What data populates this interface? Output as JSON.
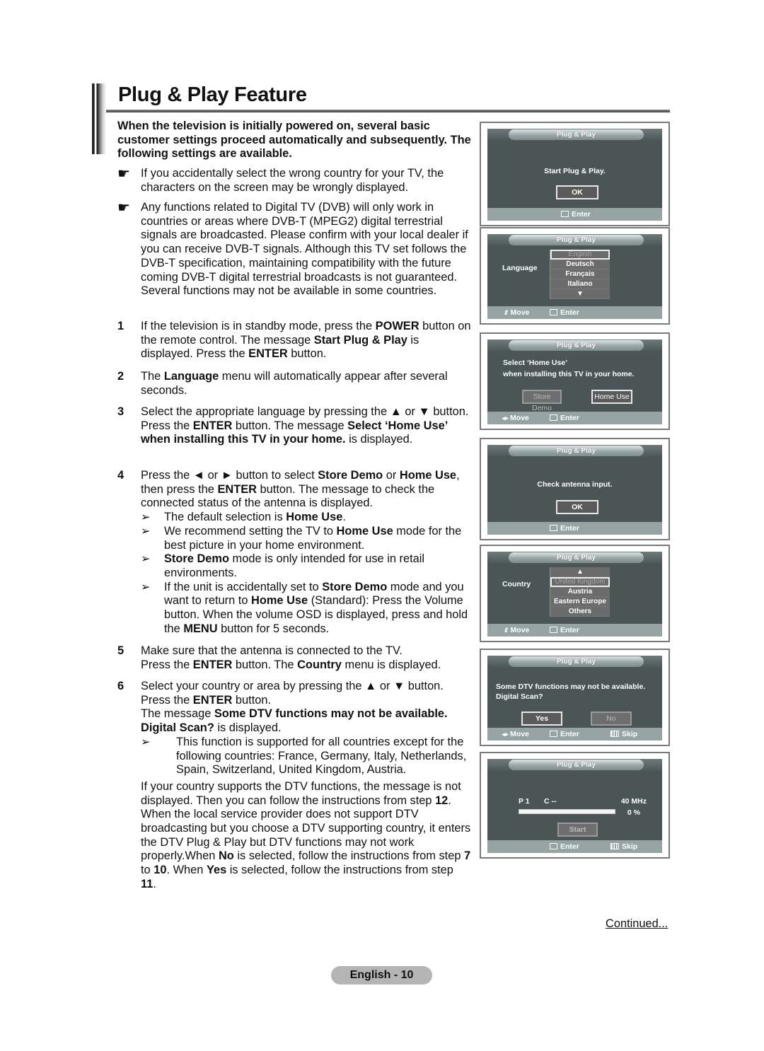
{
  "header": {
    "title": "Plug & Play Feature"
  },
  "intro": "When the television is initially powered on, several basic customer settings proceed automatically and subsequently. The following settings are available.",
  "notes": [
    {
      "icon": "pointing-hand-icon",
      "text": "If you accidentally select the wrong country for your TV, the characters on the screen may be wrongly displayed."
    },
    {
      "icon": "pointing-hand-icon",
      "text": "Any functions related to Digital TV (DVB) will only work in countries or areas where DVB-T (MPEG2) digital terrestrial signals are broadcasted. Please confirm with your local dealer if you can receive DVB-T signals. Although this TV set follows the DVB-T specification, maintaining compatibility with the future coming DVB-T digital terrestrial broadcasts is not guaranteed. Several functions may not be available in some countries."
    }
  ],
  "steps": [
    {
      "num": "1",
      "html": "If the television is in standby mode, press the <b>POWER</b> button on the remote control. The message <b>Start Plug &amp; Play</b> is displayed. Press the <b>ENTER</b> button."
    },
    {
      "num": "2",
      "html": "The <b>Language</b> menu will automatically appear after several seconds."
    },
    {
      "num": "3",
      "html": "Select the appropriate language by pressing the ▲ or ▼ button.<br>Press the <b>ENTER</b> button. The message <b>Select ‘Home Use’ when installing this TV in your home.</b> is displayed."
    },
    {
      "num": "4",
      "html": "Press the ◄ or ► button to select <b>Store Demo</b> or <b>Home Use</b>, then press the <b>ENTER</b> button. The message to check the connected status of the antenna is displayed.",
      "subs": [
        "The default selection is <b>Home Use</b>.",
        "We recommend setting the TV to <b>Home Use</b> mode for the best picture in your home environment.",
        "<b>Store Demo</b> mode is only intended for use in retail environments.",
        "If the unit is accidentally set to <b>Store Demo</b> mode and you want to return to <b>Home Use</b> (Standard): Press the Volume button. When the volume OSD is displayed, press and hold the <b>MENU</b> button for 5 seconds."
      ]
    },
    {
      "num": "5",
      "html": "Make sure that the antenna is connected to the TV.<br>Press the <b>ENTER</b> button. The <b>Country</b> menu is displayed."
    },
    {
      "num": "6",
      "html": "Select your country or area by pressing the ▲ or ▼ button.<br>Press the <b>ENTER</b> button.<br>The message <b>Some DTV functions may not be available. Digital Scan?</b> is displayed.",
      "subs": [
        "This function is supported for all countries except for the following countries: France, Germany, Italy, Netherlands, Spain, Switzerland, United Kingdom, Austria."
      ],
      "after": "If your country supports the DTV functions, the message is not displayed. Then you can follow the instructions from step <b>12</b>. When the local service provider does not support DTV broadcasting but you choose a DTV supporting country, it enters the DTV Plug &amp; Play but DTV functions may not work properly.When <b>No</b> is selected, follow the instructions from step <b>7</b> to <b>10</b>. When <b>Yes</b> is selected, follow the instructions from step <b>11</b>."
    }
  ],
  "osd": {
    "title": "Plug & Play",
    "move": "Move",
    "enter": "Enter",
    "skip": "Skip",
    "screen1": {
      "message": "Start Plug & Play.",
      "button": "OK"
    },
    "screen2": {
      "label": "Language",
      "options": [
        "English",
        "Deutsch",
        "Français",
        "Italiano",
        "▼"
      ],
      "selected": "English"
    },
    "screen3": {
      "line1": "Select ‘Home Use’",
      "line2": "when installing this TV in your home.",
      "btn_store": "Store Demo",
      "btn_home": "Home Use"
    },
    "screen4": {
      "message": "Check antenna input.",
      "button": "OK"
    },
    "screen5": {
      "label": "Country",
      "options": [
        "▲",
        "United Kingdom",
        "Austria",
        "Eastern Europe",
        "Others"
      ],
      "selected": "United Kingdom"
    },
    "screen6": {
      "line1": "Some DTV functions may not be available.",
      "line2": "Digital Scan?",
      "btn_yes": "Yes",
      "btn_no": "No"
    },
    "screen7": {
      "program": "P  1",
      "channel": "C  --",
      "frequency": "40 MHz",
      "progress_label": "0 %",
      "progress": 0,
      "button": "Start"
    }
  },
  "footer": {
    "continued": "Continued...",
    "page": "English - 10"
  }
}
